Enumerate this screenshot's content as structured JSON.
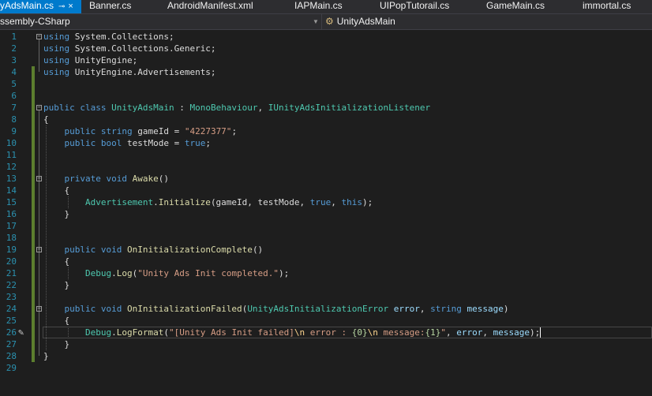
{
  "tabs": [
    {
      "label": "yAdsMain.cs",
      "active": true
    },
    {
      "label": "Banner.cs",
      "active": false
    },
    {
      "label": "AndroidManifest.xml",
      "active": false
    },
    {
      "label": "IAPMain.cs",
      "active": false
    },
    {
      "label": "UIPopTutorail.cs",
      "active": false
    },
    {
      "label": "GameMain.cs",
      "active": false
    },
    {
      "label": "immortal.cs",
      "active": false
    }
  ],
  "tab_pin_glyph": "⊸",
  "tab_close_glyph": "×",
  "navbar": {
    "project": "ssembly-CSharp",
    "member_icon": "class-icon",
    "member": "UnityAdsMain"
  },
  "colors": {
    "keyword": "#569cd6",
    "type": "#4ec9b0",
    "string": "#d69d85",
    "method": "#dcdcaa",
    "parameter": "#9cdcfe",
    "line_number": "#2b91af",
    "active_tab": "#007acc",
    "change_marker": "#5c7e2e"
  },
  "lines": [
    {
      "n": "1",
      "tokens": [
        [
          "kw",
          "using"
        ],
        [
          "tx",
          " System.Collections;"
        ]
      ]
    },
    {
      "n": "2",
      "tokens": [
        [
          "kw",
          "using"
        ],
        [
          "tx",
          " System.Collections.Generic;"
        ]
      ]
    },
    {
      "n": "3",
      "tokens": [
        [
          "kw",
          "using"
        ],
        [
          "tx",
          " UnityEngine;"
        ]
      ]
    },
    {
      "n": "4",
      "tokens": [
        [
          "kw",
          "using"
        ],
        [
          "tx",
          " UnityEngine.Advertisements;"
        ]
      ]
    },
    {
      "n": "5",
      "tokens": []
    },
    {
      "n": "6",
      "tokens": []
    },
    {
      "n": "7",
      "tokens": [
        [
          "kw",
          "public class "
        ],
        [
          "ty",
          "UnityAdsMain"
        ],
        [
          "tx",
          " : "
        ],
        [
          "ty",
          "MonoBehaviour"
        ],
        [
          "tx",
          ", "
        ],
        [
          "ty",
          "IUnityAdsInitializationListener"
        ]
      ]
    },
    {
      "n": "8",
      "tokens": [
        [
          "tx",
          "{"
        ]
      ]
    },
    {
      "n": "9",
      "tokens": [
        [
          "tx",
          "    "
        ],
        [
          "kw",
          "public string"
        ],
        [
          "tx",
          " gameId = "
        ],
        [
          "st",
          "\"4227377\""
        ],
        [
          "tx",
          ";"
        ]
      ]
    },
    {
      "n": "10",
      "tokens": [
        [
          "tx",
          "    "
        ],
        [
          "kw",
          "public bool"
        ],
        [
          "tx",
          " testMode = "
        ],
        [
          "kw",
          "true"
        ],
        [
          "tx",
          ";"
        ]
      ]
    },
    {
      "n": "11",
      "tokens": []
    },
    {
      "n": "12",
      "tokens": []
    },
    {
      "n": "13",
      "tokens": [
        [
          "tx",
          "    "
        ],
        [
          "kw",
          "private void"
        ],
        [
          "tx",
          " "
        ],
        [
          "fn",
          "Awake"
        ],
        [
          "tx",
          "()"
        ]
      ]
    },
    {
      "n": "14",
      "tokens": [
        [
          "tx",
          "    {"
        ]
      ]
    },
    {
      "n": "15",
      "tokens": [
        [
          "tx",
          "        "
        ],
        [
          "ty",
          "Advertisement"
        ],
        [
          "tx",
          "."
        ],
        [
          "fn",
          "Initialize"
        ],
        [
          "tx",
          "(gameId, testMode, "
        ],
        [
          "kw",
          "true"
        ],
        [
          "tx",
          ", "
        ],
        [
          "kw",
          "this"
        ],
        [
          "tx",
          ");"
        ]
      ]
    },
    {
      "n": "16",
      "tokens": [
        [
          "tx",
          "    }"
        ]
      ]
    },
    {
      "n": "17",
      "tokens": []
    },
    {
      "n": "18",
      "tokens": []
    },
    {
      "n": "19",
      "tokens": [
        [
          "tx",
          "    "
        ],
        [
          "kw",
          "public void"
        ],
        [
          "tx",
          " "
        ],
        [
          "fn",
          "OnInitializationComplete"
        ],
        [
          "tx",
          "()"
        ]
      ]
    },
    {
      "n": "20",
      "tokens": [
        [
          "tx",
          "    {"
        ]
      ]
    },
    {
      "n": "21",
      "tokens": [
        [
          "tx",
          "        "
        ],
        [
          "ty",
          "Debug"
        ],
        [
          "tx",
          "."
        ],
        [
          "fn",
          "Log"
        ],
        [
          "tx",
          "("
        ],
        [
          "st",
          "\"Unity Ads Init completed.\""
        ],
        [
          "tx",
          ");"
        ]
      ]
    },
    {
      "n": "22",
      "tokens": [
        [
          "tx",
          "    }"
        ]
      ]
    },
    {
      "n": "23",
      "tokens": []
    },
    {
      "n": "24",
      "tokens": [
        [
          "tx",
          "    "
        ],
        [
          "kw",
          "public void"
        ],
        [
          "tx",
          " "
        ],
        [
          "fn",
          "OnInitializationFailed"
        ],
        [
          "tx",
          "("
        ],
        [
          "ty",
          "UnityAdsInitializationError"
        ],
        [
          "tx",
          " "
        ],
        [
          "pr",
          "error"
        ],
        [
          "tx",
          ", "
        ],
        [
          "kw",
          "string"
        ],
        [
          "tx",
          " "
        ],
        [
          "pr",
          "message"
        ],
        [
          "tx",
          ")"
        ]
      ]
    },
    {
      "n": "25",
      "tokens": [
        [
          "tx",
          "    {"
        ]
      ]
    },
    {
      "n": "26",
      "tokens": [
        [
          "tx",
          "        "
        ],
        [
          "ty",
          "Debug"
        ],
        [
          "tx",
          "."
        ],
        [
          "fn",
          "LogFormat"
        ],
        [
          "tx",
          "("
        ],
        [
          "st",
          "\"[Unity Ads Init failed]"
        ],
        [
          "esc",
          "\\n"
        ],
        [
          "st",
          " error : "
        ],
        [
          "fmt",
          "{0}"
        ],
        [
          "esc",
          "\\n"
        ],
        [
          "st",
          " message:"
        ],
        [
          "fmt",
          "{1}"
        ],
        [
          "st",
          "\""
        ],
        [
          "tx",
          ", "
        ],
        [
          "pr",
          "error"
        ],
        [
          "tx",
          ", "
        ],
        [
          "pr",
          "message"
        ],
        [
          "tx",
          ");"
        ]
      ]
    },
    {
      "n": "27",
      "tokens": [
        [
          "tx",
          "    }"
        ]
      ]
    },
    {
      "n": "28",
      "tokens": [
        [
          "tx",
          "}"
        ]
      ]
    },
    {
      "n": "29",
      "tokens": []
    }
  ]
}
